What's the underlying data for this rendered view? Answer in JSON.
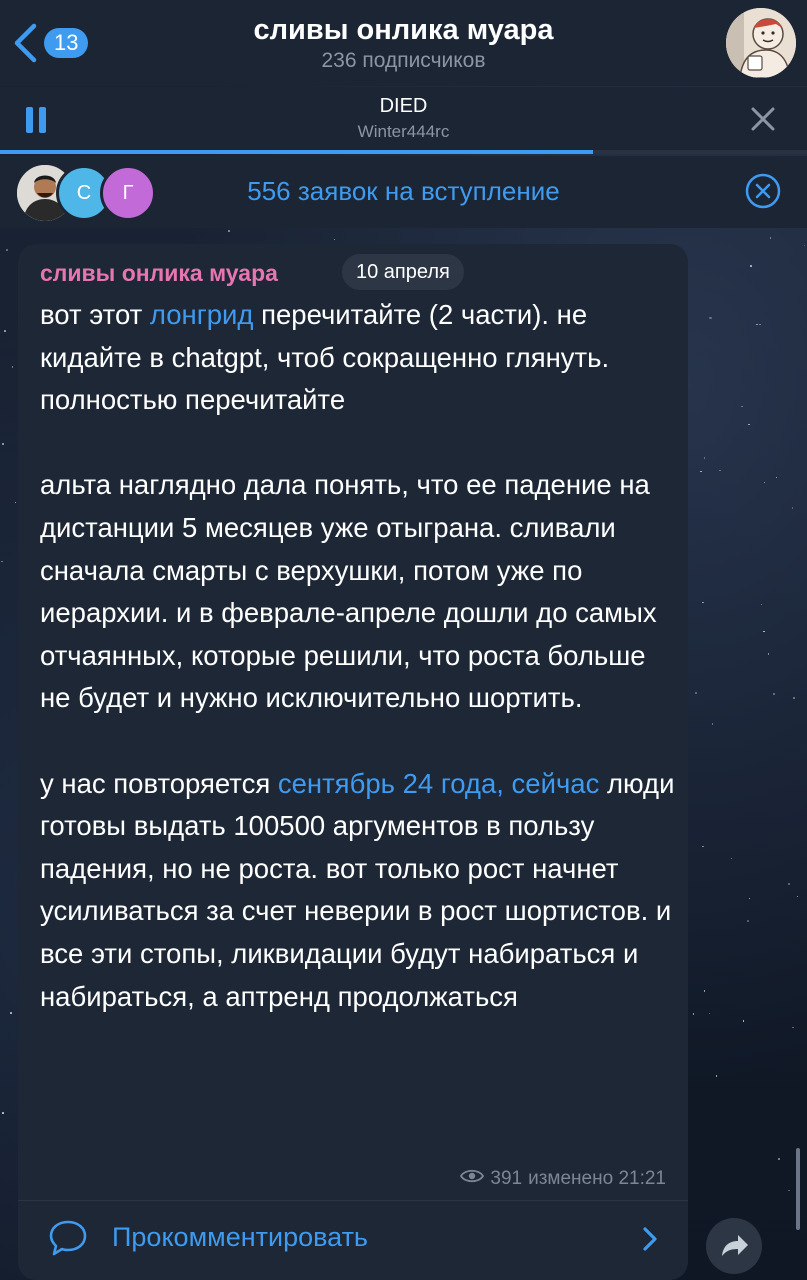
{
  "header": {
    "back_badge": "13",
    "title": "сливы онлика муара",
    "subtitle": "236 подписчиков"
  },
  "player": {
    "track_title": "DIED",
    "track_artist": "Winter444rc",
    "progress": 0.735
  },
  "requests": {
    "avatars": [
      {
        "initial": "",
        "color": "#6b5a4a"
      },
      {
        "initial": "С",
        "color": "#4fb6e8"
      },
      {
        "initial": "Г",
        "color": "#c26ad8"
      }
    ],
    "text": "556 заявок на вступление"
  },
  "message": {
    "author": "сливы онлика муара",
    "date": "10 апреля",
    "p1_a": "вот этот ",
    "p1_link": "лонгрид",
    "p1_b": " перечитайте (2 части). не кидайте в chatgpt, чтоб сокращенно глянуть. полностью перечитайте",
    "p2": "альта наглядно дала понять, что ее падение на дистанции 5 месяцев уже отыграна. сливали сначала смарты с верхушки, потом уже по иерархии. и в феврале-апреле дошли до самых отчаянных, которые решили, что роста больше не будет и нужно исключительно шортить.",
    "p3_a": "у нас повторяется ",
    "p3_link": "сентябрь 24 года, сейчас",
    "p3_b": " люди готовы выдать 100500 аргументов в пользу падения, но не роста. вот только рост начнет усиливаться за счет неверии в рост шортистов. и все эти стопы, ликвидации будут набираться и набираться, а аптренд продолжаться",
    "views": "391",
    "edited": "изменено 21:21"
  },
  "comments": {
    "label": "Прокомментировать"
  },
  "colors": {
    "accent": "#3e9bf0",
    "author": "#e776b0",
    "bubble": "#1d2735"
  }
}
